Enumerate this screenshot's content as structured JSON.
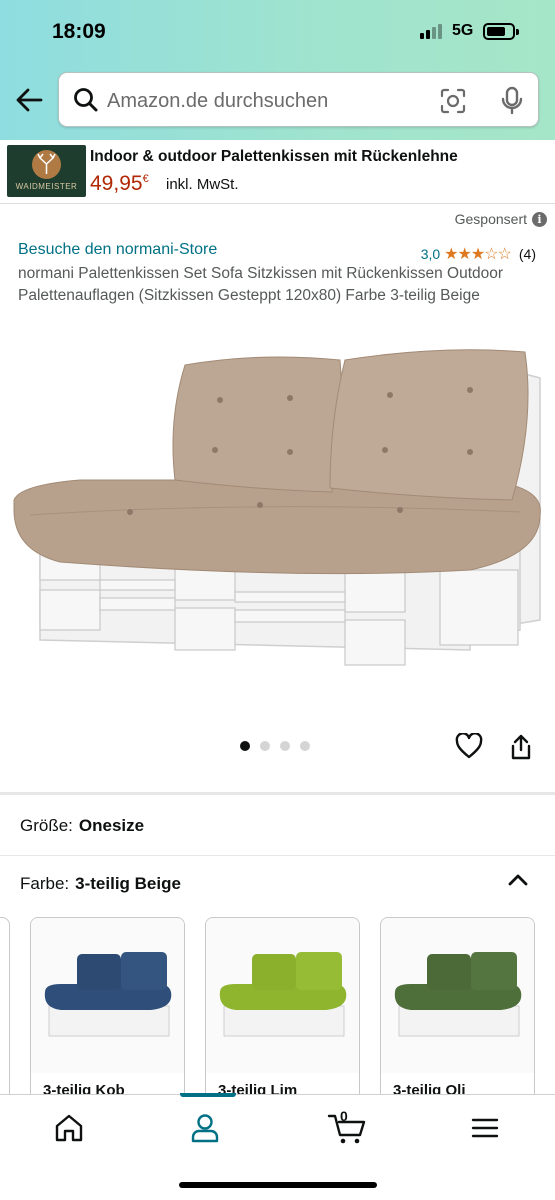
{
  "status_bar": {
    "time": "18:09",
    "network": "5G"
  },
  "search": {
    "placeholder": "Amazon.de durchsuchen"
  },
  "ad_banner": {
    "logo_text": "WAIDMEISTER",
    "title": "Indoor & outdoor Palettenkissen mit Rückenlehne",
    "price": "49,95",
    "currency": "€",
    "tax_note": "inkl. MwSt."
  },
  "sponsored_label": "Gesponsert",
  "product": {
    "store_link": "Besuche den normani-Store",
    "rating_value": "3,0",
    "rating_stars": 3,
    "rating_count": "(4)",
    "title": "normani Palettenkissen Set Sofa Sitzkissen mit Rückenkissen Outdoor Palettenauflagen (Sitzkissen Gesteppt 120x80) Farbe 3-teilig Beige",
    "image_count": 4,
    "current_image_index": 0
  },
  "variations": {
    "size_label": "Größe:",
    "size_value": "Onesize",
    "color_label": "Farbe:",
    "color_value": "3-teilig Beige",
    "swatches": [
      {
        "label": "3-teilig Kob",
        "color": "#2f4f7a"
      },
      {
        "label": "3-teilig Lim",
        "color": "#8fb52f"
      },
      {
        "label": "3-teilig Oli",
        "color": "#4e6e3a"
      }
    ]
  },
  "tab_bar": {
    "cart_count": "0"
  },
  "colors": {
    "link": "#007185",
    "price": "#b12704",
    "star": "#de7921",
    "cushion": "#b8a18c"
  }
}
